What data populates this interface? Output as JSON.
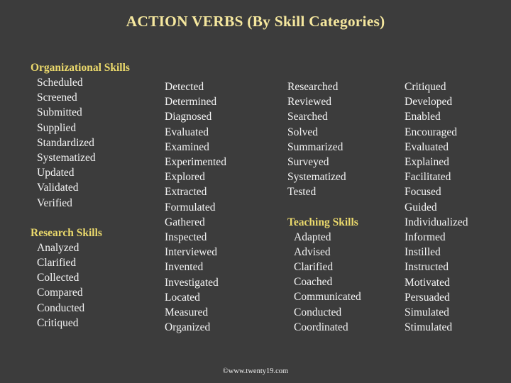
{
  "slide": {
    "title": "ACTION VERBS (By Skill Categories)",
    "footer_credit": "©www.twenty19.com",
    "colors": {
      "background": "#3c3c3c",
      "title": "#f5e79e",
      "section_heading": "#ebd96c",
      "body_text": "#f4f4f4"
    }
  },
  "columns": [
    {
      "id": "column-1",
      "blocks": [
        {
          "heading": "Organizational Skills",
          "items": [
            "Scheduled",
            "Screened",
            "Submitted",
            "Supplied",
            "Standardized",
            "Systematized",
            "Updated",
            "Validated",
            "Verified"
          ]
        },
        {
          "heading": "Research Skills",
          "items": [
            "Analyzed",
            "Clarified",
            "Collected",
            "Compared",
            "Conducted",
            "Critiqued"
          ]
        }
      ]
    },
    {
      "id": "column-2",
      "blocks": [
        {
          "heading": "",
          "items": [
            "Detected",
            "Determined",
            "Diagnosed",
            "Evaluated",
            "Examined",
            "Experimented",
            "Explored",
            "Extracted",
            "Formulated",
            "Gathered",
            "Inspected",
            "Interviewed",
            "Invented",
            "Investigated",
            "Located",
            "Measured",
            "Organized"
          ]
        }
      ]
    },
    {
      "id": "column-3",
      "blocks": [
        {
          "heading": "",
          "items": [
            "Researched",
            "Reviewed",
            "Searched",
            "Solved",
            "Summarized",
            "Surveyed",
            "Systematized",
            "Tested"
          ]
        },
        {
          "heading": "Teaching Skills",
          "items": [
            "Adapted",
            "Advised",
            "Clarified",
            "Coached",
            "Communicated",
            "Conducted",
            "Coordinated"
          ]
        }
      ]
    },
    {
      "id": "column-4",
      "blocks": [
        {
          "heading": "",
          "items": [
            "Critiqued",
            "Developed",
            "Enabled",
            "Encouraged",
            "Evaluated",
            "Explained",
            "Facilitated",
            "Focused",
            "Guided",
            "Individualized",
            "Informed",
            "Instilled",
            "Instructed",
            "Motivated",
            "Persuaded",
            "Simulated",
            "Stimulated"
          ]
        }
      ]
    }
  ]
}
